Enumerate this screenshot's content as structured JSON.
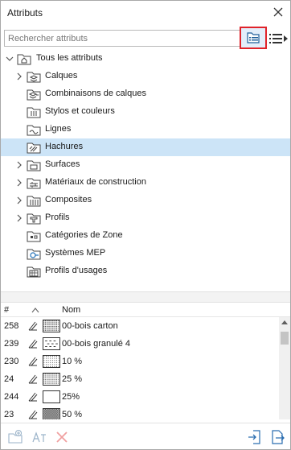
{
  "window": {
    "title": "Attributs"
  },
  "search": {
    "placeholder": "Rechercher attributs",
    "value": ""
  },
  "tree": {
    "root_label": "Tous les attributs",
    "items": [
      {
        "label": "Calques",
        "expandable": true
      },
      {
        "label": "Combinaisons de calques",
        "expandable": false
      },
      {
        "label": "Stylos et couleurs",
        "expandable": false
      },
      {
        "label": "Lignes",
        "expandable": false
      },
      {
        "label": "Hachures",
        "expandable": false,
        "selected": true
      },
      {
        "label": "Surfaces",
        "expandable": true
      },
      {
        "label": "Matériaux de construction",
        "expandable": true
      },
      {
        "label": "Composites",
        "expandable": true
      },
      {
        "label": "Profils",
        "expandable": true
      },
      {
        "label": "Catégories de Zone",
        "expandable": false
      },
      {
        "label": "Systèmes MEP",
        "expandable": false
      },
      {
        "label": "Profils d'usages",
        "expandable": false
      }
    ]
  },
  "table": {
    "columns": {
      "index": "#",
      "name": "Nom"
    },
    "rows": [
      {
        "index": "258",
        "name": "00-bois carton",
        "pattern": "dots-dense"
      },
      {
        "index": "239",
        "name": "00-bois granulé 4",
        "pattern": "dashes"
      },
      {
        "index": "230",
        "name": "10 %",
        "pattern": "dots-sparse"
      },
      {
        "index": "24",
        "name": "25 %",
        "pattern": "dots-medium"
      },
      {
        "index": "244",
        "name": "25%",
        "pattern": "empty"
      },
      {
        "index": "23",
        "name": "50 %",
        "pattern": "dots-heavy"
      }
    ]
  },
  "colors": {
    "selection": "#cce4f7",
    "highlight_border": "#e0232a",
    "accent": "#1f6fb6"
  }
}
